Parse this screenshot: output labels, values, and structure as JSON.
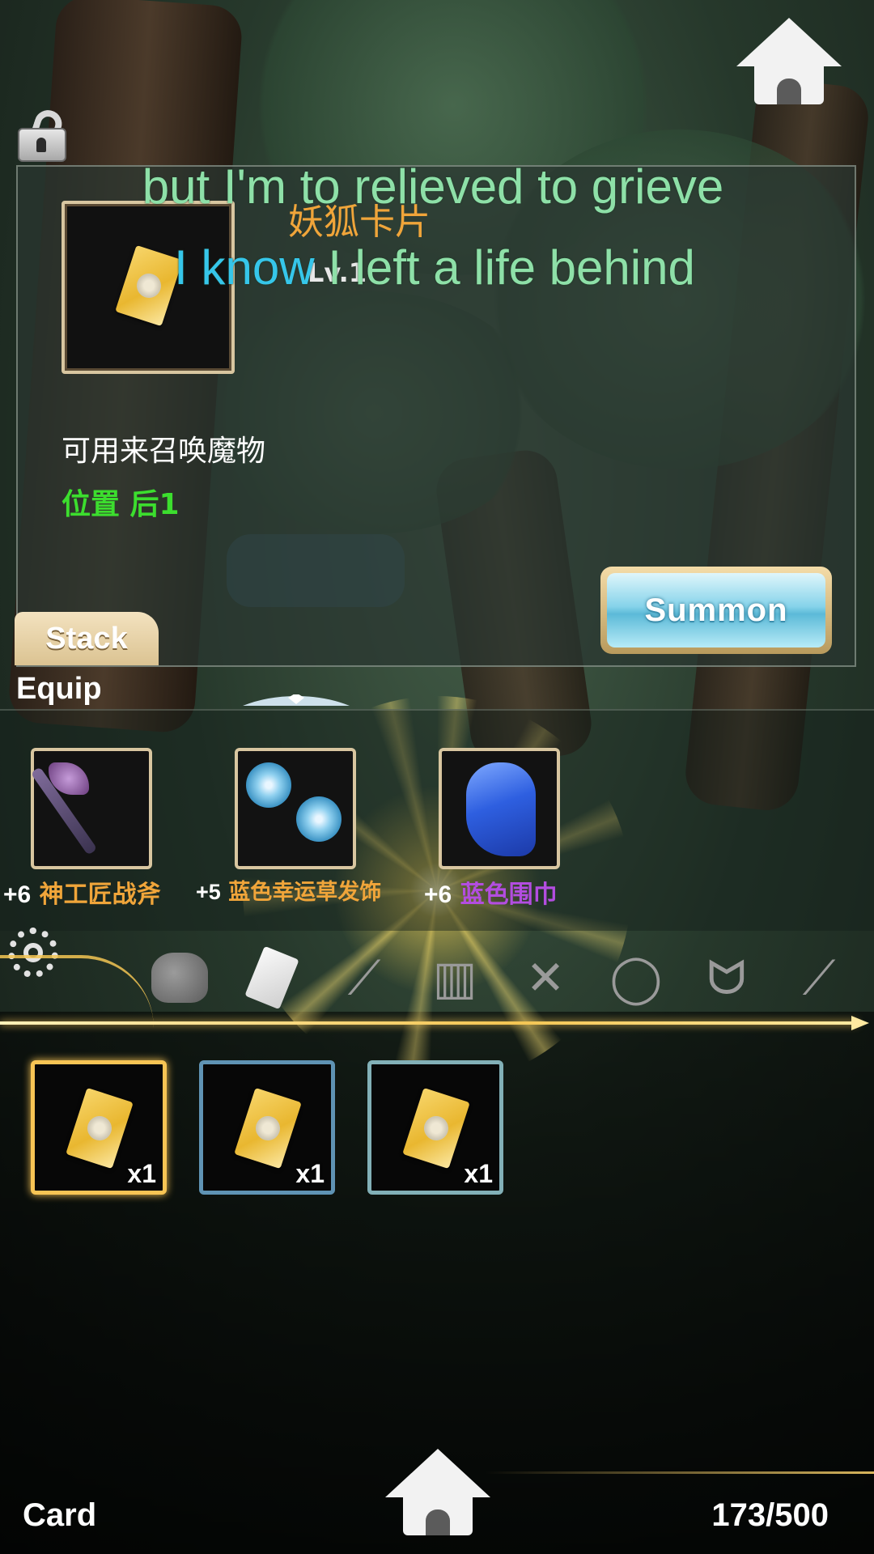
{
  "item": {
    "name": "妖狐卡片",
    "level": "Lv.1",
    "description": "可用来召唤魔物",
    "position": "位置 后1",
    "icon": "card-icon"
  },
  "lyrics": {
    "line1": "but I'm to relieved to grieve",
    "line2_highlight": "I know",
    "line2_rest": " I left a life behind"
  },
  "buttons": {
    "summon": "Summon",
    "stack": "Stack"
  },
  "equip": {
    "title": "Equip",
    "items": [
      {
        "plus": "+6",
        "name": "神工匠战斧",
        "color": "#f0a53a",
        "icon": "battle-axe-icon"
      },
      {
        "plus": "+5",
        "name": "蓝色幸运草发饰",
        "color": "#f0a53a",
        "icon": "clover-hairpin-icon"
      },
      {
        "plus": "+6",
        "name": "蓝色围巾",
        "color": "#b34de0",
        "icon": "blue-scarf-icon"
      }
    ]
  },
  "tabs": [
    "bag-icon",
    "card-icon",
    "carrot-icon",
    "book-icon",
    "cutlery-icon",
    "ring-icon",
    "cat-ears-icon",
    "sword-icon"
  ],
  "bag": {
    "items": [
      {
        "count": "x1",
        "frame": "gold",
        "icon": "card-icon"
      },
      {
        "count": "x1",
        "frame": "blue",
        "icon": "card-icon"
      },
      {
        "count": "x1",
        "frame": "teal",
        "icon": "card-icon"
      }
    ]
  },
  "footer": {
    "category": "Card",
    "capacity": "173/500"
  },
  "colors": {
    "accent_gold": "#f7c454",
    "name_orange": "#f0a53a",
    "position_green": "#3cde2e",
    "lyric_green": "#8ee0a8",
    "lyric_blue": "#36c6ea"
  }
}
